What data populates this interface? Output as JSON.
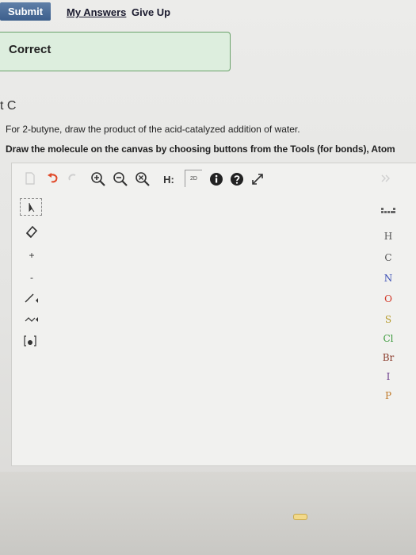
{
  "header": {
    "submit_label": "Submit",
    "my_answers_label": "My Answers",
    "give_up_label": "Give Up"
  },
  "feedback": {
    "status_label": "Correct"
  },
  "question": {
    "part_label": "t C",
    "text": "For 2-butyne, draw the product of the acid-catalyzed addition of water.",
    "instructions": "Draw the molecule on the canvas by choosing buttons from the Tools (for bonds), Atom"
  },
  "editor": {
    "toolbar": {
      "h_label": "H:",
      "two_d_label": "2D"
    },
    "atoms": [
      "H",
      "C",
      "N",
      "O",
      "S",
      "Cl",
      "Br",
      "I",
      "P"
    ],
    "atom_colors": {
      "H": "#555555",
      "C": "#555555",
      "N": "#3b4fb5",
      "O": "#d33a2a",
      "S": "#b59a2a",
      "Cl": "#3a9a3a",
      "Br": "#8a3a2a",
      "I": "#6a3a8a",
      "P": "#c07a2a"
    }
  },
  "colors": {
    "submit_bg": "#4a6b96",
    "correct_bg": "#ddeede",
    "correct_border": "#6aa26a"
  }
}
